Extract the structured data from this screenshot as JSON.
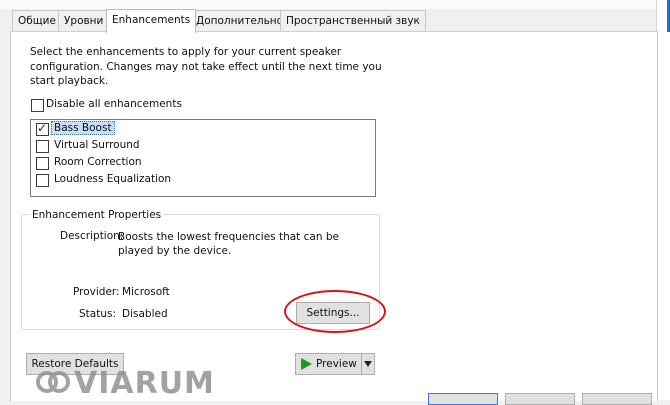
{
  "tabs": [
    {
      "label": "Общие"
    },
    {
      "label": "Уровни"
    },
    {
      "label": "Enhancements"
    },
    {
      "label": "Дополнительно"
    },
    {
      "label": "Пространственный звук"
    }
  ],
  "intro_text": "Select the enhancements to apply for your current speaker configuration. Changes may not take effect until the next time you start playback.",
  "disable_all": {
    "label": "Disable all enhancements",
    "checked": false
  },
  "enhancements": [
    {
      "label": "Bass Boost",
      "checked": true,
      "selected": true
    },
    {
      "label": "Virtual Surround",
      "checked": false,
      "selected": false
    },
    {
      "label": "Room Correction",
      "checked": false,
      "selected": false
    },
    {
      "label": "Loudness Equalization",
      "checked": false,
      "selected": false
    }
  ],
  "properties": {
    "title": "Enhancement Properties",
    "description_label": "Description:",
    "description_value": "Boosts the lowest frequencies that can be played by the device.",
    "provider_label": "Provider:",
    "provider_value": "Microsoft",
    "status_label": "Status:",
    "status_value": "Disabled",
    "settings_button": "Settings..."
  },
  "buttons": {
    "restore_defaults": "Restore Defaults",
    "preview": "Preview"
  },
  "watermark": "VIARUM",
  "colors": {
    "highlight_circle": "#d8141c",
    "play_icon": "#1e9a1e",
    "selection": "#c9dff7"
  }
}
